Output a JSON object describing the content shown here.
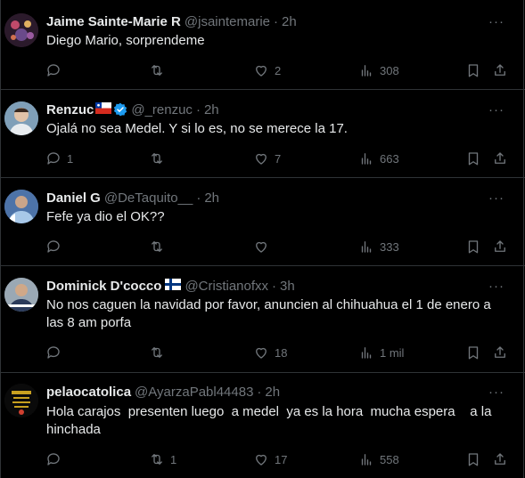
{
  "tweets": [
    {
      "name": "Jaime Sainte-Marie R",
      "handle": "@jsaintemarie",
      "separator": "·",
      "time": "2h",
      "text": "Diego Mario, sorprendeme",
      "replies": "",
      "retweets": "",
      "likes": "2",
      "views": "308"
    },
    {
      "name": "Renzuc",
      "handle": "@_renzuc",
      "separator": "·",
      "time": "2h",
      "text": "Ojalá no sea Medel. Y si lo es, no se merece la 17.",
      "replies": "1",
      "retweets": "",
      "likes": "7",
      "views": "663"
    },
    {
      "name": "Daniel G",
      "handle": "@DeTaquito__",
      "separator": "·",
      "time": "2h",
      "text": "Fefe ya dio el OK??",
      "replies": "",
      "retweets": "",
      "likes": "",
      "views": "333"
    },
    {
      "name": "Dominick D'cocco",
      "handle": "@Cristianofxx",
      "separator": "·",
      "time": "3h",
      "text": "No nos caguen la navidad por favor, anuncien al chihuahua el 1 de enero a las 8 am porfa",
      "replies": "",
      "retweets": "",
      "likes": "18",
      "views": "1 mil"
    },
    {
      "name": "pelaocatolica",
      "handle": "@AyarzaPabl44483",
      "separator": "·",
      "time": "2h",
      "text": "Hola carajos  presenten luego  a medel  ya es la hora  mucha espera    a la hinchada",
      "replies": "",
      "retweets": "1",
      "likes": "17",
      "views": "558"
    }
  ],
  "icons": {
    "more": "more-dots-icon",
    "reply": "reply-icon",
    "retweet": "retweet-icon",
    "like": "heart-icon",
    "views": "views-icon",
    "bookmark": "bookmark-icon",
    "share": "share-icon",
    "verified": "verified-badge-icon"
  },
  "colors": {
    "background": "#000000",
    "text": "#e7e9ea",
    "muted": "#71767b",
    "border": "#2f3336",
    "verified": "#1d9bf0"
  }
}
